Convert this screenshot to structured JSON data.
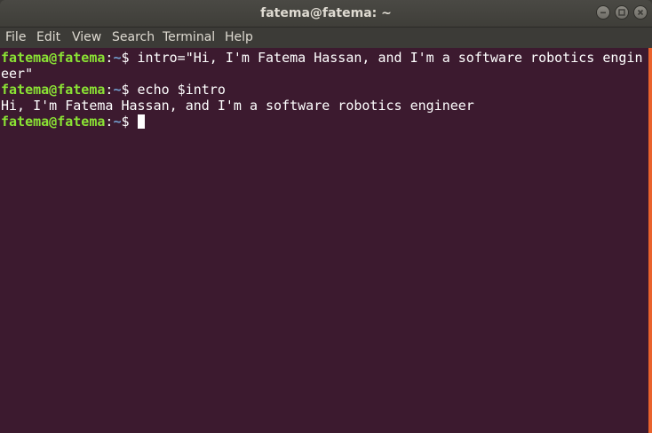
{
  "window": {
    "title": "fatema@fatema: ~"
  },
  "menu": {
    "file": "File",
    "edit": "Edit",
    "view": "View",
    "search": "Search",
    "terminal": "Terminal",
    "help": "Help"
  },
  "colors": {
    "terminal_bg": "#3c1a2f",
    "prompt_user": "#8ae234",
    "prompt_path": "#729fcf",
    "text": "#ffffff"
  },
  "terminal": {
    "line1": {
      "user": "fatema@fatema",
      "sep": ":",
      "path": "~",
      "dollar": "$ ",
      "cmd": "intro=\"Hi, I'm Fatema Hassan, and I'm a software robotics engin"
    },
    "line2": {
      "text": "eer\""
    },
    "line3": {
      "user": "fatema@fatema",
      "sep": ":",
      "path": "~",
      "dollar": "$ ",
      "cmd": "echo $intro"
    },
    "line4": {
      "text": "Hi, I'm Fatema Hassan, and I'm a software robotics engineer"
    },
    "line5": {
      "user": "fatema@fatema",
      "sep": ":",
      "path": "~",
      "dollar": "$ "
    }
  }
}
